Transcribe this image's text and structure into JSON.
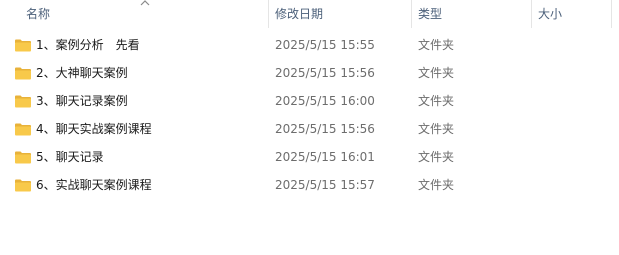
{
  "columns": {
    "name": "名称",
    "date": "修改日期",
    "type": "类型",
    "size": "大小"
  },
  "colors": {
    "header_text": "#4c607a",
    "folder_body": "#f8c94a",
    "folder_tab": "#e8b23a",
    "secondary_text": "#6d6d6d"
  },
  "rows": [
    {
      "name": "1、案例分析　先看",
      "date": "2025/5/15 15:55",
      "type": "文件夹",
      "icon": "folder-icon"
    },
    {
      "name": "2、大神聊天案例",
      "date": "2025/5/15 15:56",
      "type": "文件夹",
      "icon": "folder-icon"
    },
    {
      "name": "3、聊天记录案例",
      "date": "2025/5/15 16:00",
      "type": "文件夹",
      "icon": "folder-icon"
    },
    {
      "name": "4、聊天实战案例课程",
      "date": "2025/5/15 15:56",
      "type": "文件夹",
      "icon": "folder-icon"
    },
    {
      "name": "5、聊天记录",
      "date": "2025/5/15 16:01",
      "type": "文件夹",
      "icon": "folder-icon"
    },
    {
      "name": "6、实战聊天案例课程",
      "date": "2025/5/15 15:57",
      "type": "文件夹",
      "icon": "folder-icon"
    }
  ]
}
